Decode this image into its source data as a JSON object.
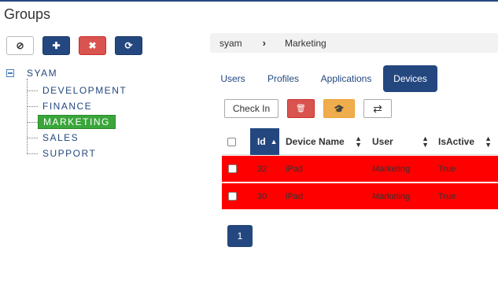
{
  "page": {
    "title": "Groups"
  },
  "toolbar": {
    "clear_icon": "ban-icon",
    "add_icon": "plus-icon",
    "delete_icon": "times-icon",
    "refresh_icon": "refresh-icon",
    "clear_glyph": "⊘",
    "add_glyph": "✚",
    "delete_glyph": "✖",
    "refresh_glyph": "⟳"
  },
  "tree": {
    "root": "SYAM",
    "items": [
      {
        "label": "DEVELOPMENT",
        "selected": false
      },
      {
        "label": "FINANCE",
        "selected": false
      },
      {
        "label": "MARKETING",
        "selected": true
      },
      {
        "label": "SALES",
        "selected": false
      },
      {
        "label": "SUPPORT",
        "selected": false
      }
    ]
  },
  "breadcrumb": {
    "items": [
      "syam",
      "Marketing"
    ],
    "separator": "›"
  },
  "tabs": [
    {
      "label": "Users",
      "active": false
    },
    {
      "label": "Profiles",
      "active": false
    },
    {
      "label": "Applications",
      "active": false
    },
    {
      "label": "Devices",
      "active": true
    }
  ],
  "actions": {
    "checkin_label": "Check In",
    "trash_glyph": "🗑",
    "graduation_glyph": "🎓",
    "transfer_glyph": "⇄"
  },
  "table": {
    "columns": [
      "Id",
      "Device Name",
      "User",
      "IsActive"
    ],
    "sort_asc_glyph": "▲",
    "sort_both_top": "▲",
    "sort_both_bottom": "▼",
    "rows": [
      {
        "id": "32",
        "device_name": "iPad",
        "user": "Marketing",
        "is_active": "True"
      },
      {
        "id": "30",
        "device_name": "iPad",
        "user": "Marketing",
        "is_active": "True"
      }
    ],
    "row_color": "#ff0000"
  },
  "pagination": {
    "current_page": "1"
  },
  "colors": {
    "primary": "#24477f",
    "danger": "#d9534f",
    "warning": "#f0ad4e",
    "selected": "#3aa63a"
  }
}
